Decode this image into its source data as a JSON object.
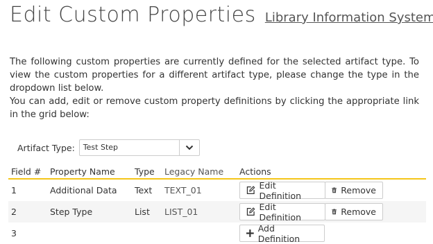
{
  "header": {
    "title": "Edit Custom Properties",
    "project_link": "Library Information System"
  },
  "intro": {
    "paragraph1": "The following custom properties are currently defined for the selected artifact type. To view the custom properties for a different artifact type, please change the type in the dropdown list below.",
    "paragraph2": "You can add, edit or remove custom property definitions by clicking the appropriate link in the grid below:"
  },
  "filter": {
    "label": "Artifact Type:",
    "selected": "Test Step"
  },
  "table": {
    "headers": [
      "Field #",
      "Property Name",
      "Type",
      "Legacy Name",
      "Actions"
    ],
    "rows": [
      {
        "field": "1",
        "name": "Additional Data",
        "type": "Text",
        "legacy": "TEXT_01",
        "edit": "Edit Definition",
        "remove": "Remove"
      },
      {
        "field": "2",
        "name": "Step Type",
        "type": "List",
        "legacy": "LIST_01",
        "edit": "Edit Definition",
        "remove": "Remove"
      }
    ],
    "add_row": {
      "field": "3",
      "add": "Add Definition"
    }
  },
  "colors": {
    "header_underline": "#f5c518",
    "alt_row": "#f5f5f5",
    "border": "#cccccc"
  }
}
